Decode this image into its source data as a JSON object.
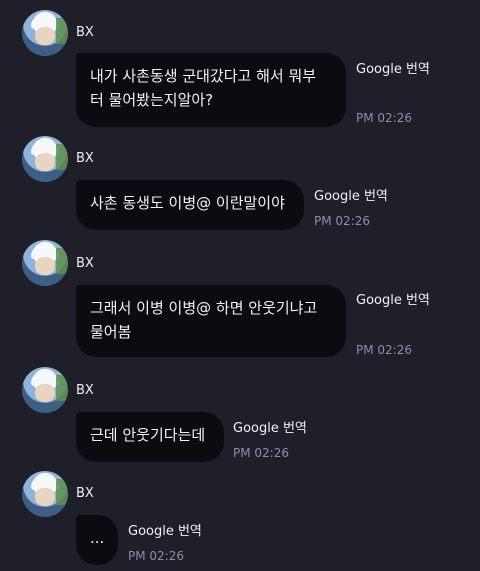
{
  "messages": [
    {
      "sender": "BX",
      "text_lines": [
        "내가 사촌동생 군대갔다고 해서 뭐부",
        "터 물어봤는지알아?"
      ],
      "translate": "Google 번역",
      "time": "PM 02:26"
    },
    {
      "sender": "BX",
      "text_lines": [
        "사촌 동생도 이병@ 이란말이야"
      ],
      "translate": "Google 번역",
      "time": "PM 02:26"
    },
    {
      "sender": "BX",
      "text_lines": [
        "그래서 이병 이병@ 하면 안웃기냐고",
        "물어봄"
      ],
      "translate": "Google 번역",
      "time": "PM 02:26"
    },
    {
      "sender": "BX",
      "text_lines": [
        "근데 안웃기다는데"
      ],
      "translate": "Google 번역",
      "time": "PM 02:26"
    },
    {
      "sender": "BX",
      "text_lines": [
        "..."
      ],
      "translate": "Google 번역",
      "time": "PM 02:26"
    }
  ],
  "icons": {
    "avatar": "profile-photo"
  },
  "colors": {
    "background": "#1e1f29",
    "bubble": "#0b0b10",
    "time": "#8d8fa3"
  }
}
